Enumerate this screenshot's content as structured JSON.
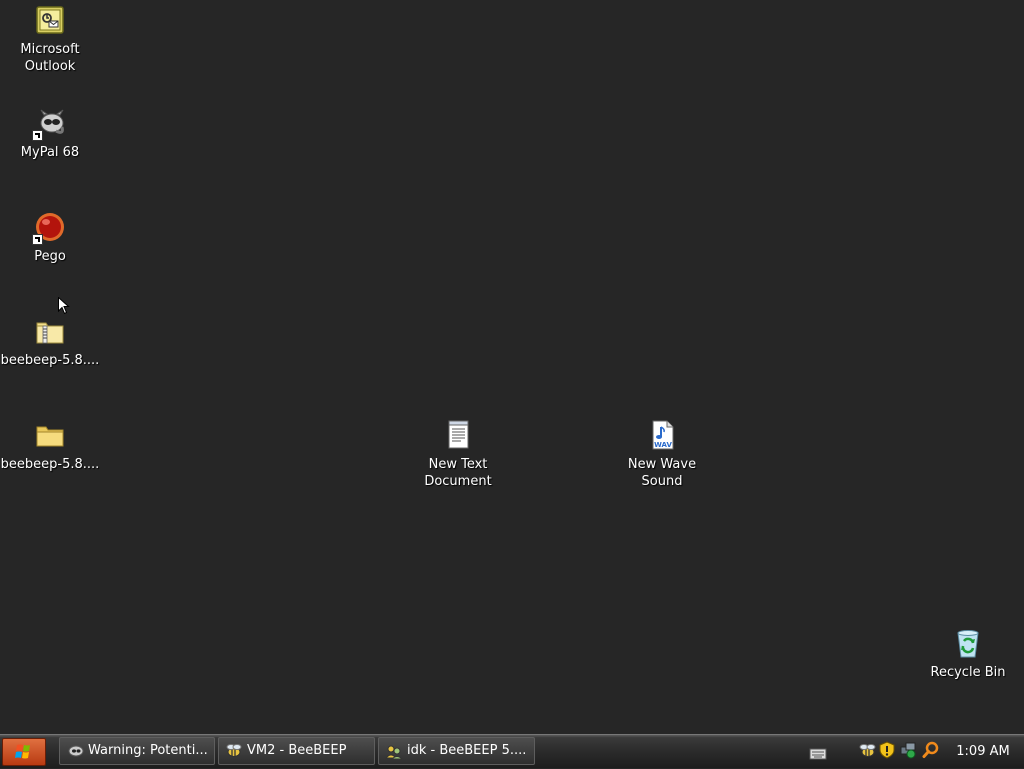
{
  "desktop": {
    "icons": [
      {
        "label": "Microsoft\nOutlook",
        "icon": "outlook-icon"
      },
      {
        "label": "MyPal 68",
        "icon": "mypal-icon",
        "shortcut": true
      },
      {
        "label": "Pego",
        "icon": "pego-icon",
        "shortcut": true
      },
      {
        "label": "beebeep-5.8....",
        "icon": "zip-folder-icon"
      },
      {
        "label": "beebeep-5.8....",
        "icon": "folder-icon"
      },
      {
        "label": "New Text\nDocument",
        "icon": "text-document-icon"
      },
      {
        "label": "New Wave\nSound",
        "icon": "wav-file-icon"
      },
      {
        "label": "Recycle Bin",
        "icon": "recycle-bin-icon"
      }
    ]
  },
  "taskbar": {
    "start_icon": "windows-logo-icon",
    "tasks": [
      {
        "label": "Warning: Potenti...",
        "icon": "mypal-icon"
      },
      {
        "label": "VM2 - BeeBEEP",
        "icon": "beebeep-icon"
      },
      {
        "label": "idk - BeeBEEP 5....",
        "icon": "beebeep-users-icon"
      }
    ],
    "tray_icons": [
      "keyboard-icon",
      "beebeep-tray-icon",
      "security-shield-icon",
      "network-icon",
      "search-icon"
    ],
    "clock": "1:09 AM"
  },
  "colors": {
    "desktop_background": "#262626",
    "taskbar": "#2b2b2b",
    "start_button": "#c84a1c"
  }
}
